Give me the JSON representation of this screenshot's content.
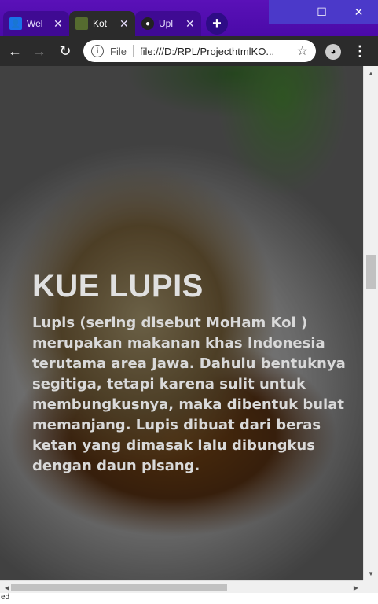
{
  "browser": {
    "tabs": [
      {
        "title": "Wel",
        "icon": "profile-icon",
        "active": false
      },
      {
        "title": "Kot",
        "icon": "page-thumbnail-icon",
        "active": true
      },
      {
        "title": "Upl",
        "icon": "github-icon",
        "active": false
      }
    ],
    "new_tab_label": "+",
    "window_controls": {
      "minimize": "—",
      "maximize": "☐",
      "close": "✕"
    },
    "nav": {
      "back": "←",
      "forward": "→",
      "reload": "↻"
    },
    "address": {
      "scheme_label": "File",
      "url": "file:///D:/RPL/ProjecthtmlKO..."
    },
    "menu_glyph": "⋮"
  },
  "page": {
    "title": "KUE LUPIS",
    "description": "Lupis (sering disebut MoHam Koi ) merupakan makanan khas Indonesia terutama area Jawa. Dahulu bentuknya segitiga, tetapi karena sulit untuk membungkusnya, maka dibentuk bulat memanjang. Lupis dibuat dari beras ketan yang dimasak lalu dibungkus dengan daun pisang."
  },
  "statusbar": {
    "text": "ed"
  },
  "colors": {
    "tabstrip": "#5a11b8",
    "toolbar": "#2b2b2b",
    "title_text": "#e0e0e0"
  }
}
